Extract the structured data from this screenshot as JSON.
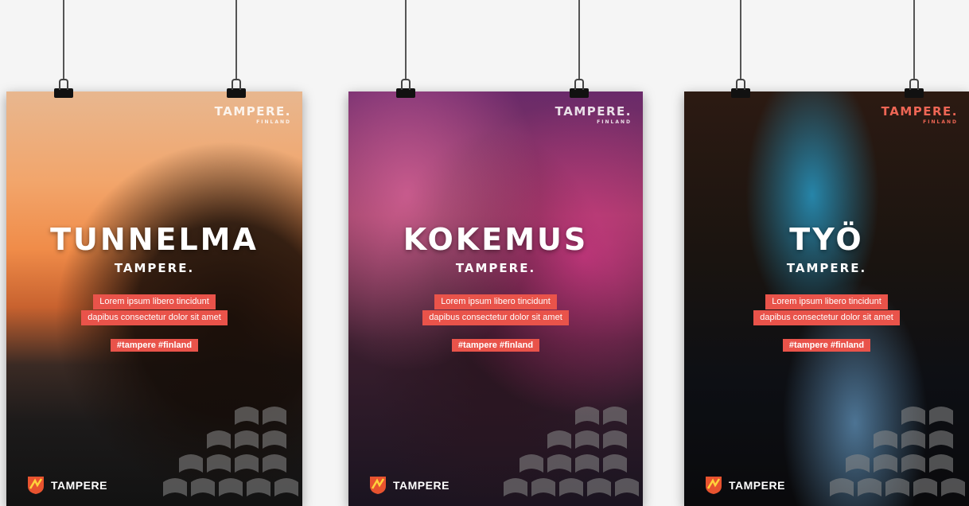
{
  "posters": [
    {
      "headline": "TUNNELMA",
      "subline": "TAMPERE.",
      "brand_top": "TAMPERE.",
      "brand_top_sub": "FINLAND",
      "lorem_line1": "Lorem ipsum libero tincidunt",
      "lorem_line2": "dapibus consectetur dolor sit amet",
      "hashtags": "#tampere #finland",
      "logo_text": "TAMPERE"
    },
    {
      "headline": "KOKEMUS",
      "subline": "TAMPERE.",
      "brand_top": "TAMPERE.",
      "brand_top_sub": "FINLAND",
      "lorem_line1": "Lorem ipsum libero tincidunt",
      "lorem_line2": "dapibus consectetur dolor sit amet",
      "hashtags": "#tampere #finland",
      "logo_text": "TAMPERE"
    },
    {
      "headline": "TYÖ",
      "subline": "TAMPERE.",
      "brand_top": "TAMPERE.",
      "brand_top_sub": "FINLAND",
      "lorem_line1": "Lorem ipsum libero tincidunt",
      "lorem_line2": "dapibus consectetur dolor sit amet",
      "hashtags": "#tampere #finland",
      "logo_text": "TAMPERE"
    }
  ],
  "colors": {
    "accent": "#e9534a",
    "background": "#f5f5f5"
  }
}
